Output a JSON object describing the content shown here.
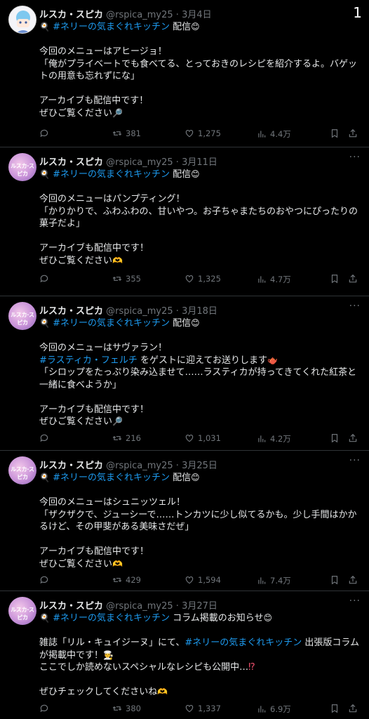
{
  "corner_number": "1",
  "tweets": [
    {
      "avatar_text": "",
      "name": "ルスカ・スピカ",
      "handle": "@rspica_my25",
      "date": "3月4日",
      "line1_tag": "#ネリーの気まぐれキッチン",
      "line1_rest": " 配信",
      "p1": "今回のメニューはアヒージョ！",
      "p2": "「俺がプライベートでも食べてる、とっておきのレシピを紹介するよ。バゲットの用意も忘れずにな」",
      "p3": "アーカイブも配信中です！",
      "p4": "ぜひご覧ください",
      "replies": "",
      "retweets": "381",
      "likes": "1,275",
      "views": "4.4万"
    },
    {
      "avatar_text": "ルスカ·スピカ",
      "name": "ルスカ・スピカ",
      "handle": "@rspica_my25",
      "date": "3月11日",
      "line1_tag": "#ネリーの気まぐれキッチン",
      "line1_rest": " 配信",
      "p1": "今回のメニューはパンプティング！",
      "p2": "「かりかりで、ふわふわの、甘いやつ。お子ちゃまたちのおやつにぴったりの菓子だよ」",
      "p3": "アーカイブも配信中です！",
      "p4": "ぜひご覧ください",
      "replies": "",
      "retweets": "355",
      "likes": "1,325",
      "views": "4.7万"
    },
    {
      "avatar_text": "ルスカ·スピカ",
      "name": "ルスカ・スピカ",
      "handle": "@rspica_my25",
      "date": "3月18日",
      "line1_tag": "#ネリーの気まぐれキッチン",
      "line1_rest": " 配信",
      "p1": "今回のメニューはサヴァラン！",
      "p1b_tag": "#ラスティカ・フェルチ",
      "p1b_rest": " をゲストに迎えてお送りします",
      "p2": "「シロップをたっぷり染み込ませて……ラスティカが持ってきてくれた紅茶と一緒に食べようか」",
      "p3": "アーカイブも配信中です！",
      "p4": "ぜひご覧ください",
      "replies": "",
      "retweets": "216",
      "likes": "1,031",
      "views": "4.2万"
    },
    {
      "avatar_text": "ルスカ·スピカ",
      "name": "ルスカ・スピカ",
      "handle": "@rspica_my25",
      "date": "3月25日",
      "line1_tag": "#ネリーの気まぐれキッチン",
      "line1_rest": " 配信",
      "p1": "今回のメニューはシュニッツェル！",
      "p2": "「ザクザクで、ジューシーで……トンカツに少し似てるかも。少し手間はかかるけど、その甲斐がある美味さだぜ」",
      "p3": "アーカイブも配信中です！",
      "p4": "ぜひご覧ください",
      "replies": "",
      "retweets": "429",
      "likes": "1,594",
      "views": "7.4万"
    },
    {
      "avatar_text": "ルスカ·スピカ",
      "name": "ルスカ・スピカ",
      "handle": "@rspica_my25",
      "date": "3月27日",
      "line1_tag": "#ネリーの気まぐれキッチン",
      "line1_rest": " コラム掲載のお知らせ",
      "p1a": "雑誌「リル・キュイジーヌ」にて、",
      "p1_tag": "#ネリーの気まぐれキッチン",
      "p1b": " 出張版コラムが掲載中です！",
      "p2": "ここでしか読めないスペシャルなレシピも公開中…",
      "p3": "ぜひチェックしてくださいね",
      "replies": "",
      "retweets": "380",
      "likes": "1,337",
      "views": "6.9万"
    }
  ],
  "colors": {
    "background": "#000000",
    "text": "#e7e9ea",
    "muted": "#71767b",
    "link": "#1d9bf0",
    "divider": "#2f3336"
  },
  "icons": [
    "reply-icon",
    "retweet-icon",
    "like-icon",
    "views-icon",
    "bookmark-icon",
    "share-icon",
    "more-icon",
    "pan-icon",
    "smile-icon",
    "magnifier-icon",
    "heart-hands-icon",
    "teapot-icon",
    "chef-icon"
  ]
}
